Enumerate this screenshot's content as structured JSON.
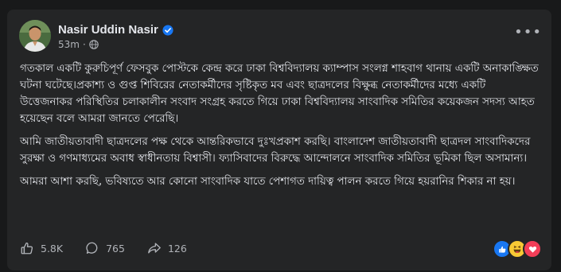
{
  "post": {
    "author": "Nasir Uddin Nasir",
    "time": "53m",
    "visibility_icon": "globe-icon",
    "more_label": "•••",
    "paragraphs": [
      "গতকাল একটি কুরুচিপূর্ণ ফেসবুক পোস্টকে কেন্দ্র করে  ঢাকা বিশ্ববিদ্যালয় ক্যাম্পাস সংলগ্ন শাহবাগ থানায় একটি অনাকাঙ্ক্ষিত ঘটনা ঘটেছে।প্রকাশ্য ও গুপ্ত শিবিরের নেতাকর্মীদের সৃষ্টিকৃত মব এবং ছাত্রদলের বিক্ষুব্ধ নেতাকর্মীদের মধ্যে একটি উত্তেজনাকর পরিস্থিতির চলাকালীন সংবাদ সংগ্রহ করতে গিয়ে ঢাকা বিশ্ববিদ্যালয় সাংবাদিক সমিতির কয়েকজন সদস্য আহত হয়েছেন বলে আমরা জানতে পেরেছি।",
      "আমি জাতীয়তাবাদী ছাত্রদলের পক্ষ থেকে আন্তরিকভাবে দুঃখপ্রকাশ করছি। বাংলাদেশ জাতীয়তাবাদী ছাত্রদল সাংবাদিকদের সুরক্ষা ও গণমাধ্যমের অবাধ স্বাধীনতায় বিশ্বাসী। ফ্যাসিবাদের বিরুদ্ধে আন্দোলনে সাংবাদিক সমিতির ভূমিকা ছিল অসামান্য।",
      "আমরা আশা করছি, ভবিষ্যতে আর কোনো সাংবাদিক যাতে পেশাগত দায়িত্ব পালন করতে গিয়ে হয়রানির শিকার না হয়।"
    ]
  },
  "stats": {
    "likes": "5.8K",
    "comments": "765",
    "shares": "126"
  },
  "colors": {
    "background": "#18191a",
    "card": "#242526",
    "text": "#e4e6eb",
    "muted": "#b0b3b8",
    "like_blue": "#1877f2",
    "haha_yellow": "#f7c935",
    "love_red": "#f33e58"
  }
}
